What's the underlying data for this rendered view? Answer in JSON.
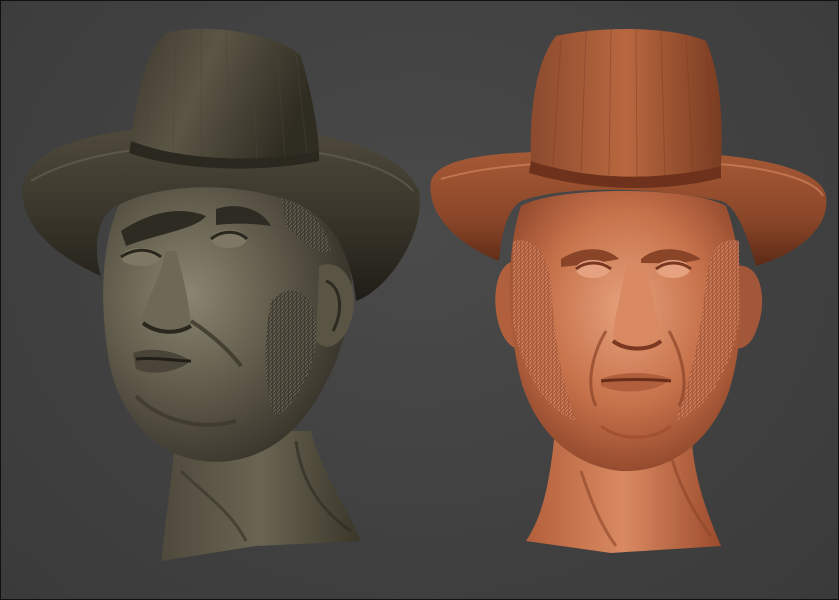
{
  "scene": {
    "background": "#424242",
    "left_material": {
      "base": "#5a5446",
      "shadow": "#2b2820",
      "highlight": "#8c8570"
    },
    "right_material": {
      "base": "#c06a44",
      "shadow": "#6e321c",
      "highlight": "#e8a07a"
    }
  }
}
